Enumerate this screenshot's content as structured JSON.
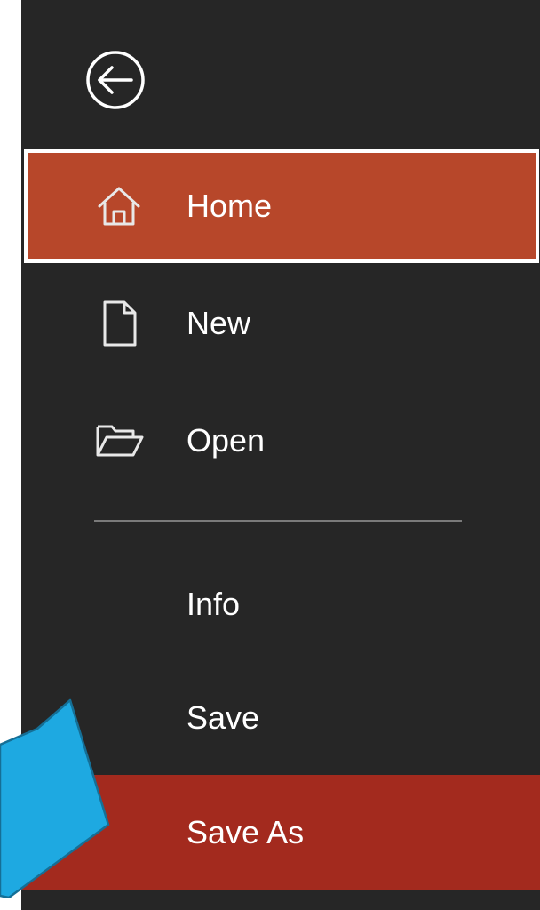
{
  "backstage": {
    "back_icon": "back-arrow-icon",
    "items": [
      {
        "label": "Home",
        "icon": "home-icon",
        "selected": true
      },
      {
        "label": "New",
        "icon": "new-document-icon"
      },
      {
        "label": "Open",
        "icon": "open-folder-icon"
      },
      {
        "label": "Info"
      },
      {
        "label": "Save"
      },
      {
        "label": "Save As",
        "highlighted": true
      }
    ]
  },
  "colors": {
    "panel_bg": "#262626",
    "home_selected": "#b7472a",
    "save_as_highlight": "#a32a1e",
    "callout_arrow": "#1ea9e1"
  }
}
